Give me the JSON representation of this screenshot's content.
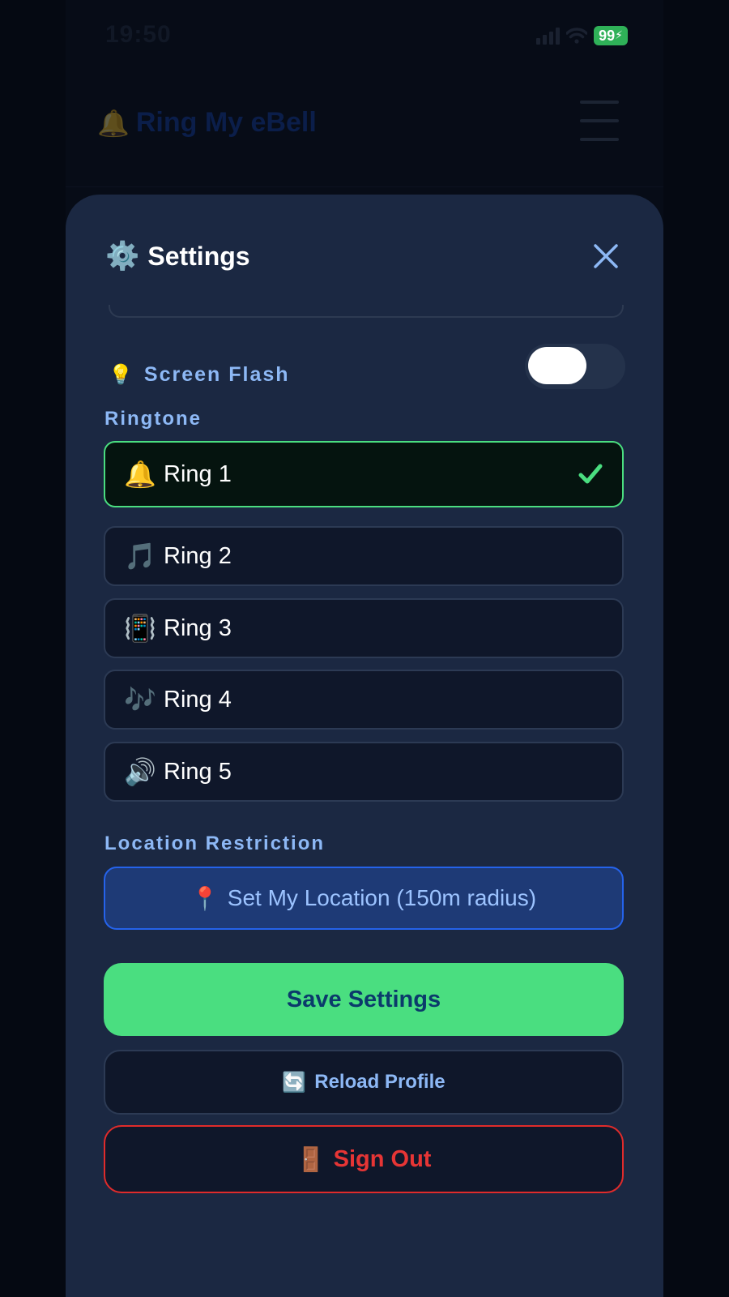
{
  "status_bar": {
    "time": "19:50",
    "battery": "99"
  },
  "app_header": {
    "bell_icon": "🔔",
    "title": "Ring My eBell",
    "menu_icon": "hamburger-icon"
  },
  "settings": {
    "title": "Settings",
    "gear_icon": "⚙️",
    "close_icon": "close-icon",
    "screen_flash": {
      "icon": "💡",
      "label": "Screen Flash",
      "enabled": false
    },
    "ringtone_label": "Ringtone",
    "ringtones": [
      {
        "icon": "🔔",
        "label": "Ring 1",
        "selected": true
      },
      {
        "icon": "🎵",
        "label": "Ring 2",
        "selected": false
      },
      {
        "icon": "📳",
        "label": "Ring 3",
        "selected": false
      },
      {
        "icon": "🎶",
        "label": "Ring 4",
        "selected": false
      },
      {
        "icon": "🔊",
        "label": "Ring 5",
        "selected": false
      }
    ],
    "location_label": "Location Restriction",
    "location_button": {
      "icon": "📍",
      "label": "Set My Location (150m radius)"
    },
    "save_label": "Save Settings",
    "reload": {
      "icon": "🔄",
      "label": "Reload Profile"
    },
    "signout": {
      "icon": "🚪",
      "label": "Sign Out"
    }
  },
  "colors": {
    "accent_green": "#4ade80",
    "accent_blue": "#8db8f5",
    "danger_red": "#e63535",
    "sheet_bg": "#1b2842"
  }
}
